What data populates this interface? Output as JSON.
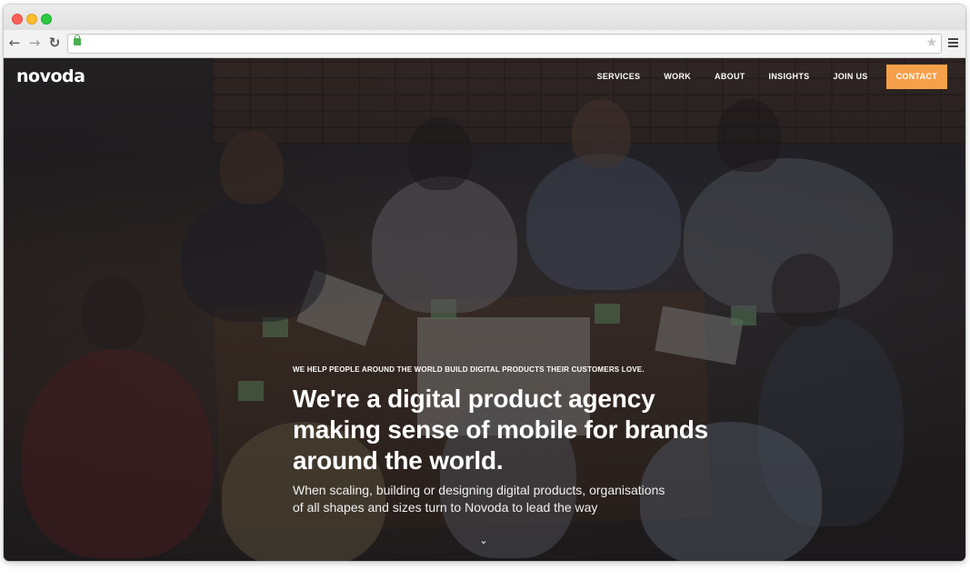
{
  "browser": {
    "url": "",
    "icons": {
      "back": "arrow-left-icon",
      "forward": "arrow-right-icon",
      "reload": "reload-icon",
      "lock": "lock-icon",
      "bookmark": "star-icon",
      "menu": "hamburger-menu-icon"
    }
  },
  "site": {
    "logo_text": "novoda",
    "nav": [
      {
        "label": "SERVICES"
      },
      {
        "label": "WORK"
      },
      {
        "label": "ABOUT"
      },
      {
        "label": "INSIGHTS"
      },
      {
        "label": "JOIN US"
      },
      {
        "label": "CONTACT"
      }
    ],
    "accent_color": "#f7a04b"
  },
  "hero": {
    "eyebrow": "WE HELP PEOPLE AROUND THE WORLD BUILD DIGITAL PRODUCTS THEIR CUSTOMERS LOVE.",
    "headline": "We're a digital product agency making sense of mobile for brands around the world.",
    "subheadline": "When scaling, building or designing digital products, organisations of all shapes and sizes turn to Novoda to lead the way",
    "scroll_icon": "chevron-down-icon"
  }
}
